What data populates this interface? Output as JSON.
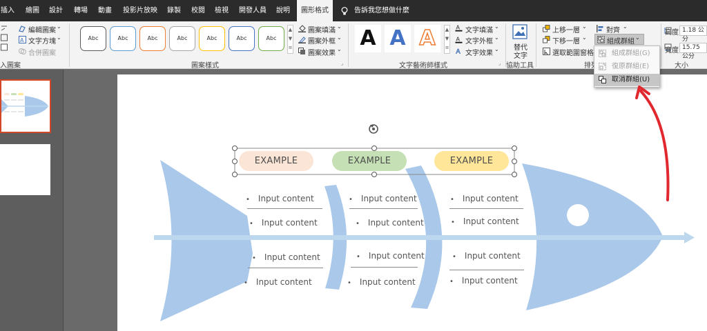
{
  "tabs": [
    {
      "label": "插入"
    },
    {
      "label": "繪圖"
    },
    {
      "label": "設計"
    },
    {
      "label": "轉場"
    },
    {
      "label": "動畫"
    },
    {
      "label": "投影片放映"
    },
    {
      "label": "錄製"
    },
    {
      "label": "校閱"
    },
    {
      "label": "檢視"
    },
    {
      "label": "開發人員"
    },
    {
      "label": "說明"
    },
    {
      "label": "圖形格式"
    }
  ],
  "tell_me": "告訴我您想做什麼",
  "ribbon": {
    "insert_shapes": {
      "edit_shape": "編輯圖案",
      "text_box": "文字方塊",
      "merge_shapes": "合併圖案",
      "label": "入圖案"
    },
    "shape_styles": {
      "label": "圖案樣式",
      "swatch_text": "Abc",
      "swatch_colors": [
        "#595959",
        "#5b9bd5",
        "#ed7d31",
        "#a5a5a5",
        "#ffc000",
        "#4472c4",
        "#70ad47"
      ],
      "fill": "圖案填滿",
      "outline": "圖案外框",
      "effects": "圖案效果"
    },
    "wordart": {
      "label": "文字藝術師樣式",
      "letter": "A",
      "text_fill": "文字填滿",
      "text_outline": "文字外框",
      "text_effects": "文字效果"
    },
    "accessibility": {
      "label": "協助工具",
      "alt_text_line1": "替代",
      "alt_text_line2": "文字"
    },
    "arrange": {
      "label": "排列",
      "bring_forward": "上移一層",
      "send_backward": "下移一層",
      "selection_pane": "選取範圍窗格",
      "align": "對齊",
      "group": "組成群組"
    },
    "size": {
      "label": "大小",
      "height_label": "高度:",
      "height_value": "1.18 公分",
      "width_label": "寬度:",
      "width_value": "15.75 公分"
    }
  },
  "group_menu": {
    "items": [
      {
        "label": "組成群組(G)",
        "enabled": false
      },
      {
        "label": "復原群組(E)",
        "enabled": false
      },
      {
        "label": "取消群組(U)",
        "enabled": true
      }
    ]
  },
  "slide": {
    "pills": [
      {
        "label": "EXAMPLE",
        "color": "#fbe5d6"
      },
      {
        "label": "EXAMPLE",
        "color": "#c5e0b4"
      },
      {
        "label": "EXAMPLE",
        "color": "#ffe699"
      }
    ],
    "bullets": [
      "Input content",
      "Input content",
      "Input content",
      "Input content",
      "Input content",
      "Input content",
      "Input content",
      "Input content",
      "Input content",
      "Input content",
      "Input content",
      "Input content"
    ],
    "fish_color": "#a9c8ea",
    "arrow_color": "#bdd7ee"
  },
  "colors": {
    "accent_red": "#e0282e",
    "thumbnail_selected_border": "#d24726"
  }
}
